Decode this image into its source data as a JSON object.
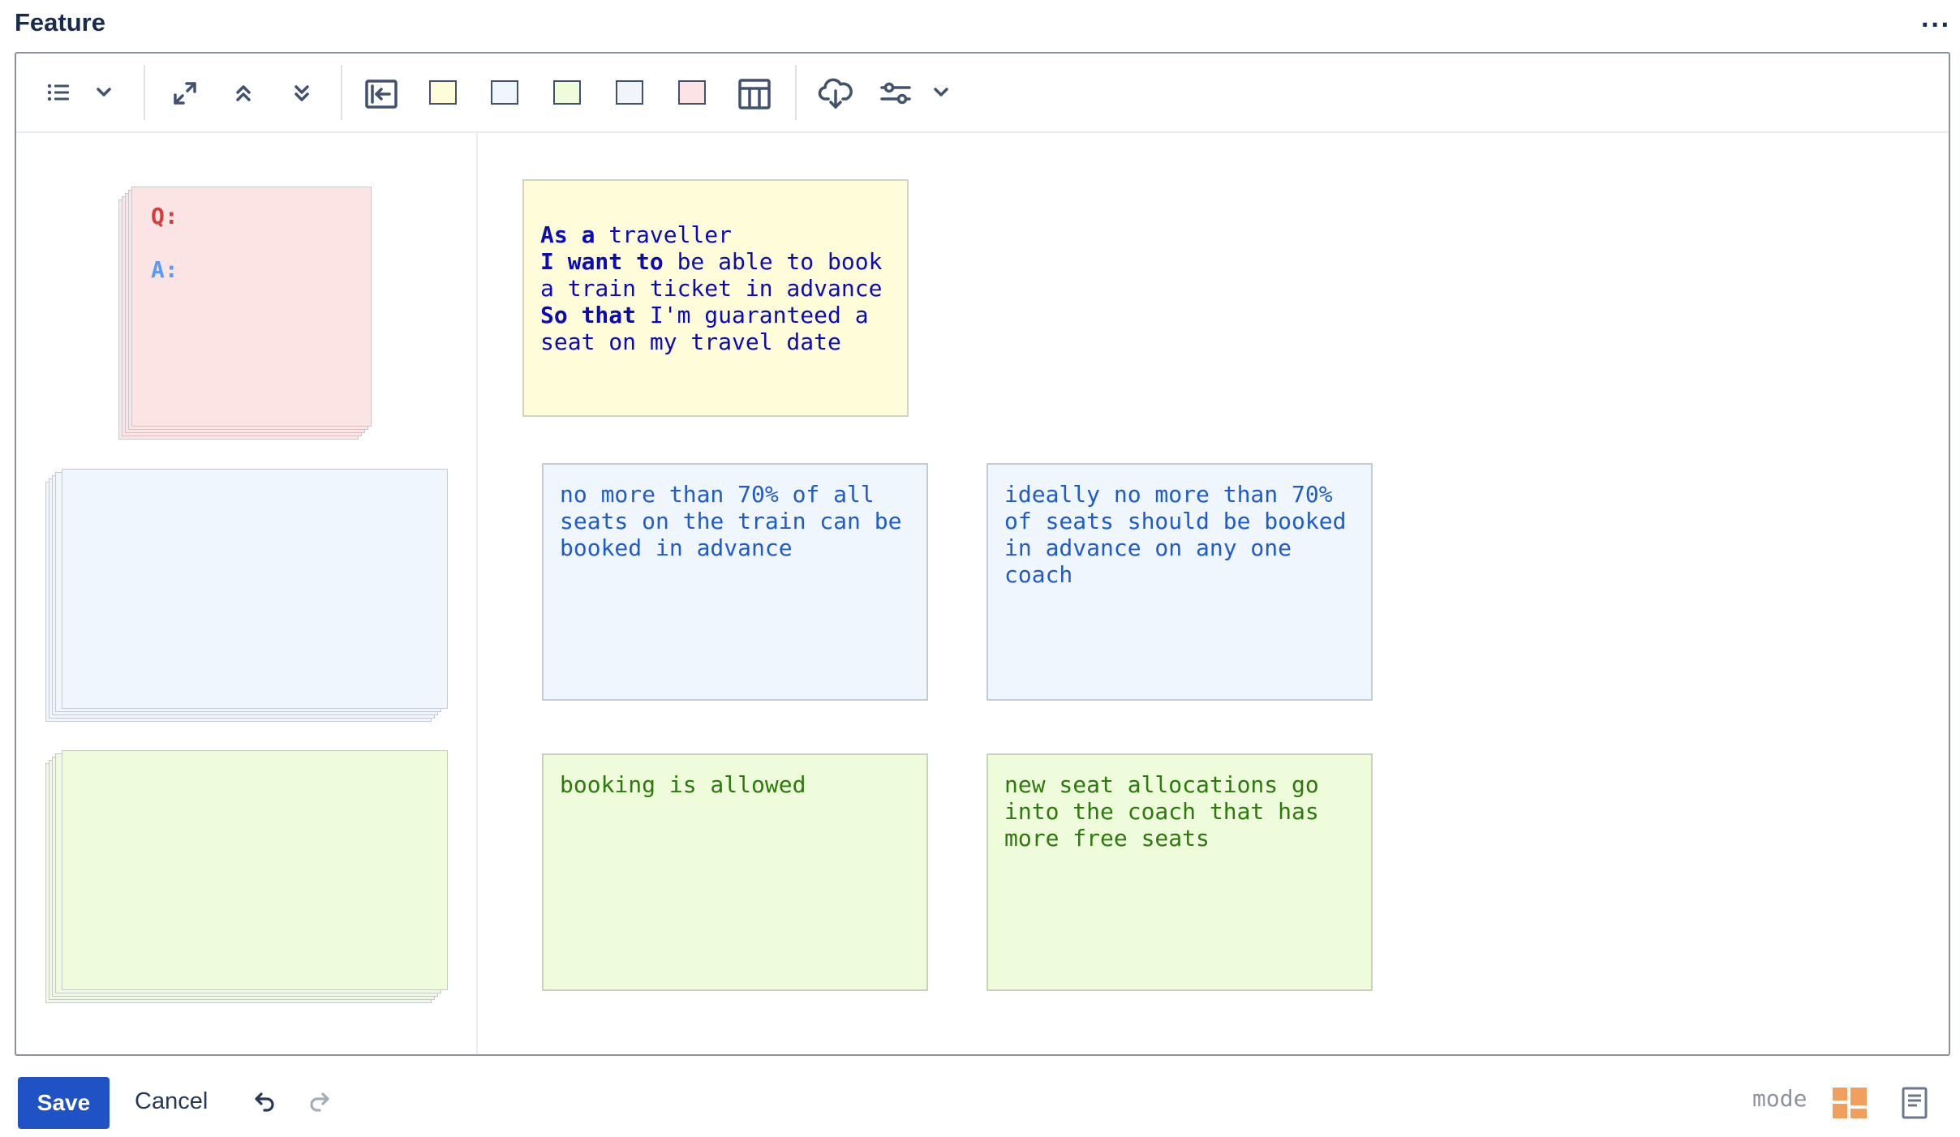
{
  "panel": {
    "title": "Feature",
    "more_menu": "···"
  },
  "toolbar": {
    "icons": [
      "list-icon",
      "chevron-down-icon",
      "expand-icon",
      "collapse-up-icon",
      "collapse-down-icon",
      "sidebar-toggle-icon",
      "yellow-card-swatch",
      "blue-card-swatch",
      "green-card-swatch",
      "grey-card-swatch",
      "red-card-swatch",
      "table-layout-icon",
      "cloud-download-icon",
      "settings-sliders-icon",
      "chevron-down-icon"
    ],
    "colors": {
      "yellow": "#fffdd9",
      "blue": "#eff6fd",
      "green": "#eefcdc",
      "grey": "#f1f4fa",
      "red": "#fbe4e3"
    }
  },
  "sidebar": {
    "question_card": {
      "q_label": "Q:",
      "a_label": "A:"
    }
  },
  "story": {
    "lines": [
      {
        "kw": "As a",
        "text": " traveller"
      },
      {
        "kw": "I want to",
        "text": " be able to book\na train ticket in advance"
      },
      {
        "kw": "So that",
        "text": " I'm guaranteed a\nseat on my travel date"
      }
    ]
  },
  "rules": [
    {
      "text": "no more than 70% of all\nseats on the train can be\nbooked in advance"
    },
    {
      "text": "ideally no more than 70%\nof seats should be booked\nin advance on any one\ncoach"
    }
  ],
  "examples": [
    {
      "text": "booking is allowed"
    },
    {
      "text": "new seat allocations go\ninto the coach that has\nmore free seats"
    }
  ],
  "footer": {
    "save_label": "Save",
    "cancel_label": "Cancel",
    "mode_label": "mode"
  }
}
